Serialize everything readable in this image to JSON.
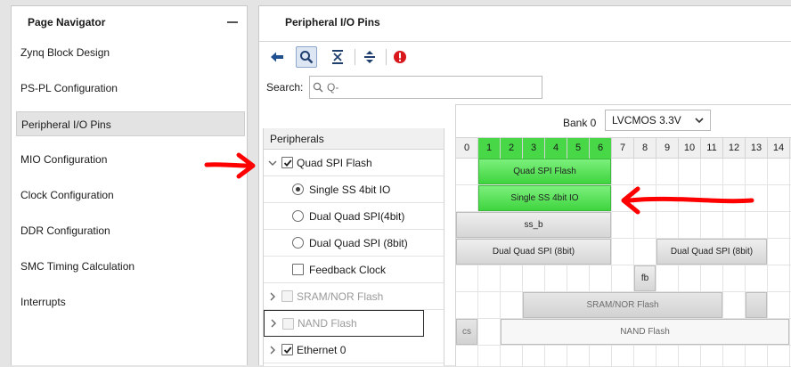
{
  "navigator": {
    "title": "Page Navigator",
    "items": [
      {
        "label": "Zynq Block Design",
        "selected": false
      },
      {
        "label": "PS-PL Configuration",
        "selected": false
      },
      {
        "label": "Peripheral I/O Pins",
        "selected": true
      },
      {
        "label": "MIO Configuration",
        "selected": false
      },
      {
        "label": "Clock Configuration",
        "selected": false
      },
      {
        "label": "DDR Configuration",
        "selected": false
      },
      {
        "label": "SMC Timing Calculation",
        "selected": false
      },
      {
        "label": "Interrupts",
        "selected": false
      }
    ]
  },
  "main": {
    "title": "Peripheral I/O Pins",
    "toolbar": [
      "back-icon",
      "search-icon",
      "collapse-all-icon",
      "expand-all-icon",
      "error-icon"
    ]
  },
  "search": {
    "label": "Search:",
    "placeholder": "Q-",
    "value": ""
  },
  "peripherals": {
    "header": "Peripherals",
    "rows": [
      {
        "type": "group",
        "label": "Quad SPI Flash",
        "checked": true,
        "enabled": true,
        "expanded": true
      },
      {
        "type": "radio",
        "label": "Single SS 4bit IO",
        "selected": true
      },
      {
        "type": "radio",
        "label": "Dual Quad SPI(4bit)",
        "selected": false
      },
      {
        "type": "radio",
        "label": "Dual Quad SPI (8bit)",
        "selected": false
      },
      {
        "type": "checkbox",
        "label": "Feedback Clock",
        "checked": false
      },
      {
        "type": "group",
        "label": "SRAM/NOR Flash",
        "checked": false,
        "enabled": false,
        "expanded": false
      },
      {
        "type": "group",
        "label": "NAND Flash",
        "checked": false,
        "enabled": false,
        "expanded": false
      },
      {
        "type": "group",
        "label": "Ethernet 0",
        "checked": true,
        "enabled": true,
        "expanded": false
      }
    ]
  },
  "bank": {
    "label": "Bank 0",
    "voltage": "LVCMOS 3.3V"
  },
  "pins": {
    "numbers": [
      "0",
      "1",
      "2",
      "3",
      "4",
      "5",
      "6",
      "7",
      "8",
      "9",
      "10",
      "11",
      "12",
      "13",
      "14"
    ],
    "active": [
      1,
      2,
      3,
      4,
      5,
      6
    ],
    "blocks": [
      {
        "label": "Quad SPI Flash",
        "row": 0,
        "start": 1,
        "span": 6,
        "style": "green"
      },
      {
        "label": "Single SS 4bit IO",
        "row": 1,
        "start": 1,
        "span": 6,
        "style": "green"
      },
      {
        "label": "ss_b",
        "row": 2,
        "start": 0,
        "span": 7,
        "style": "grey"
      },
      {
        "label": "Dual Quad SPI (8bit)",
        "row": 3,
        "start": 0,
        "span": 7,
        "style": "grey"
      },
      {
        "label": "Dual Quad SPI (8bit)",
        "row": 3,
        "start": 9,
        "span": 5,
        "style": "grey"
      },
      {
        "label": "fb",
        "row": 4,
        "start": 8,
        "span": 1,
        "style": "grey"
      },
      {
        "label": "SRAM/NOR Flash",
        "row": 5,
        "start": 3,
        "span": 9,
        "style": "grey-light"
      },
      {
        "label": "",
        "row": 5,
        "start": 13,
        "span": 1,
        "style": "grey-light"
      },
      {
        "label": "cs",
        "row": 6,
        "start": 0,
        "span": 1,
        "style": "grey-light"
      },
      {
        "label": "NAND Flash",
        "row": 6,
        "start": 2,
        "span": 13,
        "style": "white"
      }
    ]
  },
  "colors": {
    "active_pin": "#47d747",
    "annotation_arrow": "#ff0000"
  }
}
